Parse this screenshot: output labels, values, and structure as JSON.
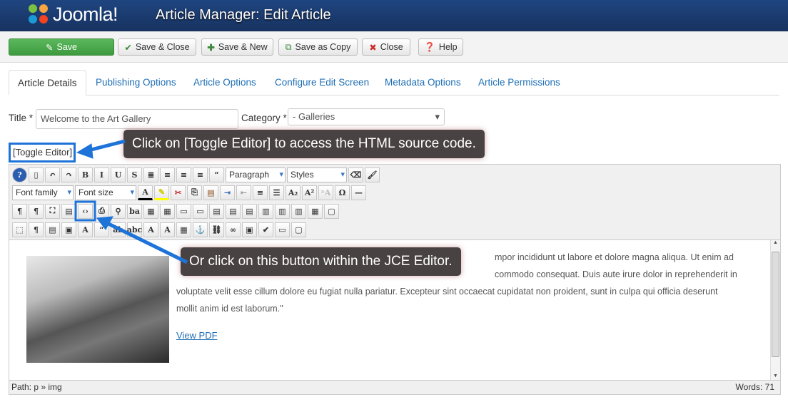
{
  "header": {
    "logo_text": "Joomla!",
    "title": "Article Manager: Edit Article"
  },
  "toolbar": {
    "save": "Save",
    "save_close": "Save & Close",
    "save_new": "Save & New",
    "save_copy": "Save as Copy",
    "close": "Close",
    "help": "Help"
  },
  "tabs": [
    {
      "label": "Article Details",
      "active": true
    },
    {
      "label": "Publishing Options"
    },
    {
      "label": "Article Options"
    },
    {
      "label": "Configure Edit Screen"
    },
    {
      "label": "Metadata Options"
    },
    {
      "label": "Article Permissions"
    }
  ],
  "form": {
    "title_label": "Title *",
    "title_value": "Welcome to the Art Gallery",
    "category_label": "Category *",
    "category_value": "- Galleries",
    "toggle_editor": "[Toggle Editor]"
  },
  "callouts": {
    "toggle": "Click on [Toggle Editor] to access the HTML source code.",
    "button": "Or click on this button within the JCE Editor."
  },
  "editor": {
    "format_select": "Paragraph",
    "styles_select": "Styles",
    "font_family": "Font family",
    "font_size": "Font size",
    "row1": [
      "help-icon",
      "new-document-icon",
      "undo-icon",
      "redo-icon",
      "bold-icon",
      "italic-icon",
      "underline-icon",
      "strikethrough-icon",
      "align-justify-icon",
      "align-center-icon",
      "align-left-icon",
      "align-right-icon",
      "blockquote-icon"
    ],
    "row3": [
      "ltr-icon",
      "rtl-icon",
      "fullscreen-icon",
      "preview-icon",
      "source-code-icon",
      "print-icon",
      "search-icon",
      "replace-icon",
      "table-icon",
      "delete-table-icon",
      "row-props-icon",
      "cell-props-icon",
      "insert-row-before-icon",
      "insert-row-after-icon",
      "delete-row-icon",
      "insert-col-before-icon",
      "insert-col-after-icon",
      "delete-col-icon",
      "split-cells-icon",
      "merge-cells-icon"
    ],
    "row4": [
      "visual-aid-icon",
      "show-blocks-icon",
      "template-icon",
      "anchor-box-icon",
      "style-icon",
      "cite-icon",
      "abbr-icon",
      "acronym-icon",
      "del-icon",
      "ins-icon",
      "attributes-icon",
      "anchor-icon",
      "unlink-icon",
      "link-icon",
      "image-icon",
      "spellcheck-icon",
      "hr-icon",
      "layer-icon"
    ]
  },
  "content": {
    "line1": "mpor incididunt ut labore et dolore magna aliqua. Ut enim ad",
    "line2": "commodo consequat. Duis aute irure dolor in reprehenderit in",
    "line3": "voluptate velit esse cillum dolore eu fugiat nulla pariatur. Excepteur sint occaecat cupidatat non proident, sunt in culpa qui officia deserunt",
    "line4": "mollit anim id est laborum.\"",
    "link": "View PDF"
  },
  "status": {
    "path": "Path:  p » img",
    "words": "Words: 71"
  },
  "colors": {
    "header": "#1a3867",
    "save": "#4cae4c",
    "link": "#1f6fb5",
    "highlight": "#1e73d9"
  }
}
